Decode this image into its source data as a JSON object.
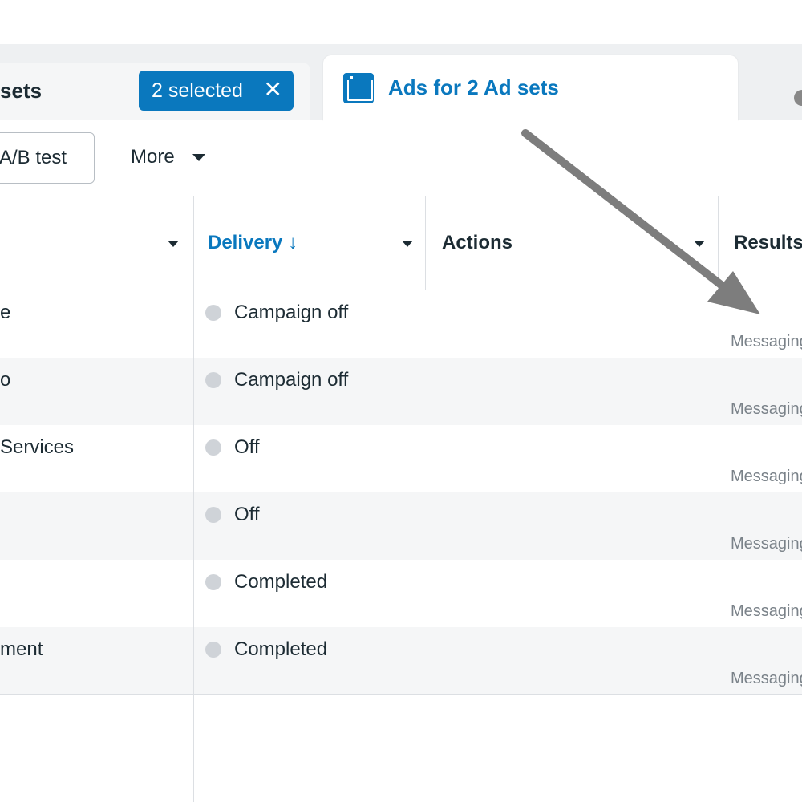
{
  "tabs": {
    "adsets_label": "sets",
    "selection_chip": "2 selected",
    "chip_close": "✕",
    "ads_label": "Ads for 2 Ad sets"
  },
  "toolbar": {
    "ab_test_label": "A/B test",
    "more_label": "More"
  },
  "table": {
    "headers": {
      "delivery": "Delivery ↓",
      "actions": "Actions",
      "results": "Results"
    },
    "rows": [
      {
        "name": "e",
        "delivery": "Campaign off",
        "result": "Messaging"
      },
      {
        "name": "o",
        "delivery": "Campaign off",
        "result": "Messaging"
      },
      {
        "name": "Services",
        "delivery": "Off",
        "result": "Messaging"
      },
      {
        "name": "",
        "delivery": "Off",
        "result": "Messaging"
      },
      {
        "name": "",
        "delivery": "Completed",
        "result": "Messaging"
      },
      {
        "name": "ment",
        "delivery": "Completed",
        "result": "Messaging"
      }
    ]
  },
  "colors": {
    "accent": "#0a78be",
    "annotation_arrow": "#7d7d7d"
  }
}
